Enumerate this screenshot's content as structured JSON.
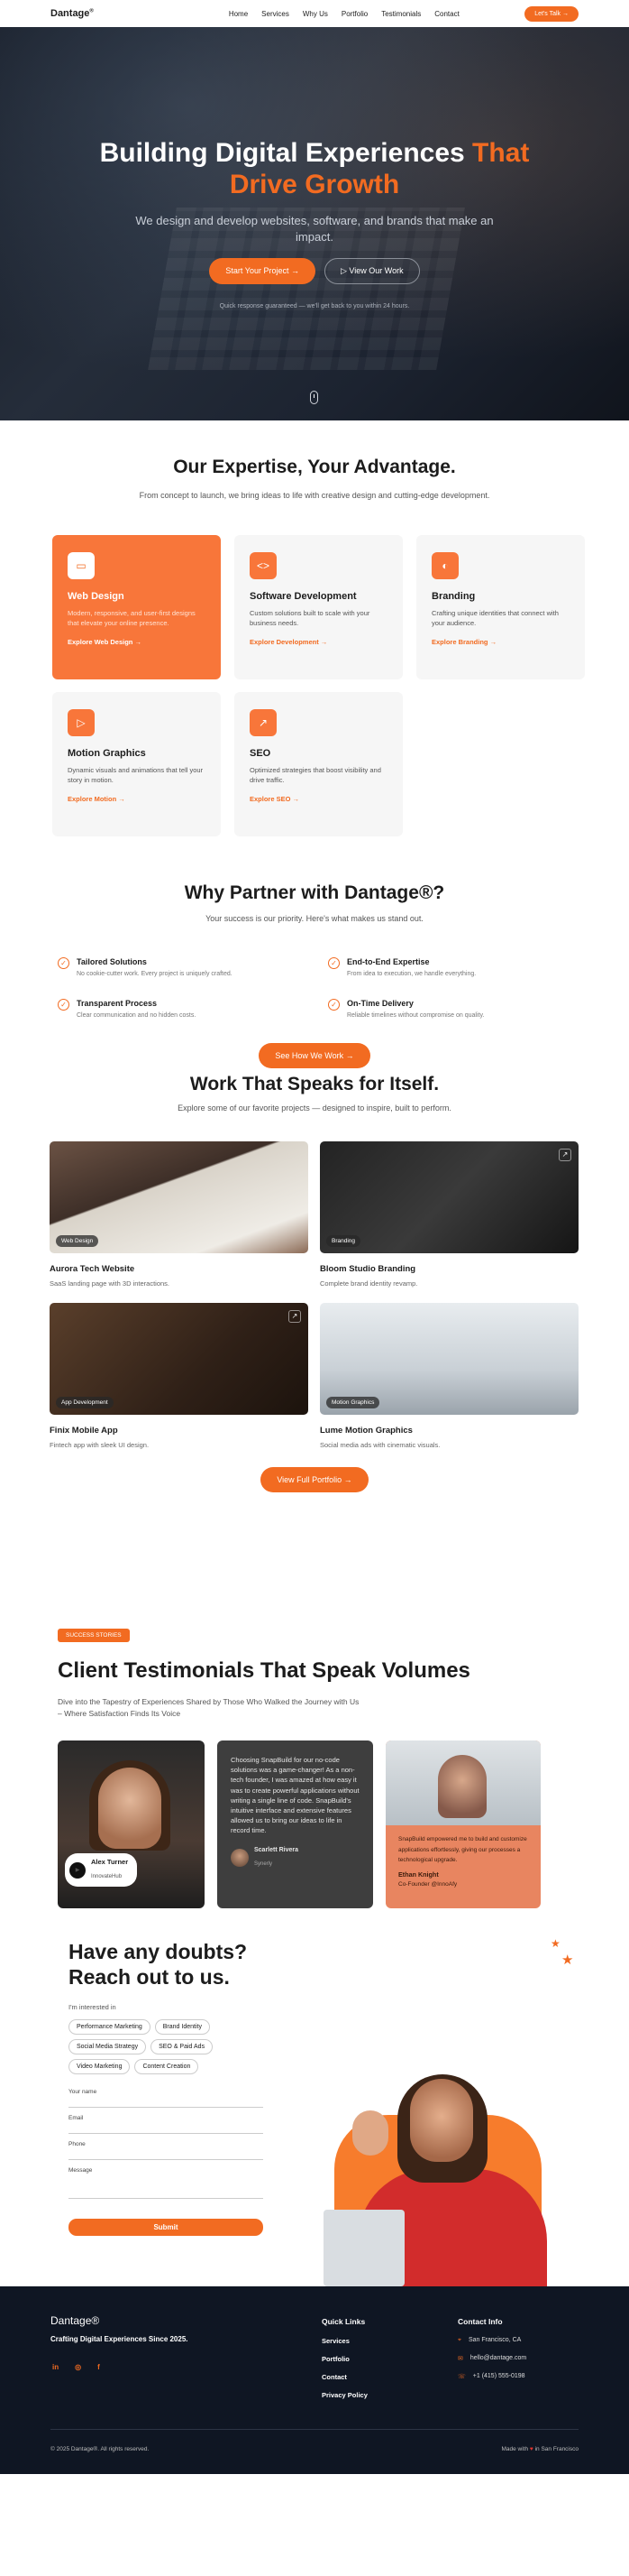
{
  "nav": {
    "logo": "Dantage",
    "logo_mark": "®",
    "links": [
      "Home",
      "Services",
      "Why Us",
      "Portfolio",
      "Testimonials",
      "Contact"
    ],
    "cta": "Let's Talk →"
  },
  "hero": {
    "title_plain": "Building Digital Experiences",
    "title_accent": "That Drive Growth",
    "subtitle": "We design and develop websites, software, and brands that make an impact.",
    "primary_btn": "Start Your Project →",
    "secondary_btn": "View Our Work",
    "note": "Quick response guaranteed — we'll get back to you within 24 hours."
  },
  "expertise": {
    "title": "Our Expertise, Your Advantage.",
    "subtitle": "From concept to launch, we bring ideas to life with creative design and cutting-edge development.",
    "cards": [
      {
        "title": "Web Design",
        "desc": "Modern, responsive, and user-first designs that elevate your online presence.",
        "link": "Explore Web Design →",
        "icon": "monitor-icon"
      },
      {
        "title": "Software Development",
        "desc": "Custom solutions built to scale with your business needs.",
        "link": "Explore Development →",
        "icon": "code-icon"
      },
      {
        "title": "Branding",
        "desc": "Crafting unique identities that connect with your audience.",
        "link": "Explore Branding →",
        "icon": "palette-icon"
      },
      {
        "title": "Motion Graphics",
        "desc": "Dynamic visuals and animations that tell your story in motion.",
        "link": "Explore Motion →",
        "icon": "play-icon"
      },
      {
        "title": "SEO",
        "desc": "Optimized strategies that boost visibility and drive traffic.",
        "link": "Explore SEO →",
        "icon": "chart-icon"
      }
    ]
  },
  "why": {
    "title": "Why Partner with Dantage®?",
    "subtitle": "Your success is our priority. Here's what makes us stand out.",
    "features": [
      {
        "title": "Tailored Solutions",
        "desc": "No cookie-cutter work. Every project is uniquely crafted."
      },
      {
        "title": "End-to-End Expertise",
        "desc": "From idea to execution, we handle everything."
      },
      {
        "title": "Transparent Process",
        "desc": "Clear communication and no hidden costs."
      },
      {
        "title": "On-Time Delivery",
        "desc": "Reliable timelines without compromise on quality."
      }
    ],
    "button": "See How We Work →"
  },
  "work": {
    "title": "Work That Speaks for Itself.",
    "subtitle": "Explore some of our favorite projects — designed to inspire, built to perform.",
    "projects": [
      {
        "title": "Aurora Tech Website",
        "desc": "SaaS landing page with 3D interactions.",
        "tag": "Web Design"
      },
      {
        "title": "Bloom Studio Branding",
        "desc": "Complete brand identity revamp.",
        "tag": "Branding"
      },
      {
        "title": "Finix Mobile App",
        "desc": "Fintech app with sleek UI design.",
        "tag": "App Development"
      },
      {
        "title": "Lume Motion Graphics",
        "desc": "Social media ads with cinematic visuals.",
        "tag": "Motion Graphics"
      }
    ],
    "button": "View Full Portfolio →"
  },
  "testimonials": {
    "pill": "SUCCESS STORIES",
    "title": "Client Testimonials That Speak Volumes",
    "subtitle": "Dive into the Tapestry of Experiences Shared by Those Who Walked the Journey with Us – Where Satisfaction Finds Its Voice",
    "video": {
      "name": "Alex Turner",
      "company": "InnovateHub"
    },
    "quote1": {
      "text": "Choosing SnapBuild for our no-code solutions was a game-changer! As a non-tech founder, I was amazed at how easy it was to create powerful applications without writing a single line of code. SnapBuild's intuitive interface and extensive features allowed us to bring our ideas to life in record time.",
      "name": "Scarlett Rivera",
      "company": "Synerly"
    },
    "quote2": {
      "text": "SnapBuild empowered me to build and customize applications effortlessly, giving our processes a technological upgrade.",
      "name": "Ethan Knight",
      "role": "Co-Founder @InnoAfy"
    }
  },
  "contact": {
    "title": "Have any doubts? Reach out to us.",
    "interest_label": "I'm interested in",
    "chips": [
      "Performance Marketing",
      "Brand Identity",
      "Social Media Strategy",
      "SEO & Paid Ads",
      "Video Marketing",
      "Content Creation"
    ],
    "fields": [
      "Your name",
      "Email",
      "Phone",
      "Message"
    ],
    "submit": "Submit"
  },
  "footer": {
    "logo": "Dantage®",
    "tagline": "Crafting Digital Experiences Since 2025.",
    "social": [
      "in",
      "◎",
      "f"
    ],
    "quick_links_title": "Quick Links",
    "quick_links": [
      "Services",
      "Portfolio",
      "Contact",
      "Privacy Policy"
    ],
    "contact_title": "Contact Info",
    "contact_items": [
      {
        "icon": "pin-icon",
        "text": "San Francisco, CA"
      },
      {
        "icon": "mail-icon",
        "text": "hello@dantage.com"
      },
      {
        "icon": "phone-icon",
        "text": "+1 (415) 555-0198"
      }
    ],
    "copyright": "© 2025 Dantage®. All rights reserved.",
    "made_pre": "Made with",
    "made_post": "in San Francisco"
  },
  "colors": {
    "accent": "#f26b21",
    "footer_bg": "#0f1623"
  }
}
